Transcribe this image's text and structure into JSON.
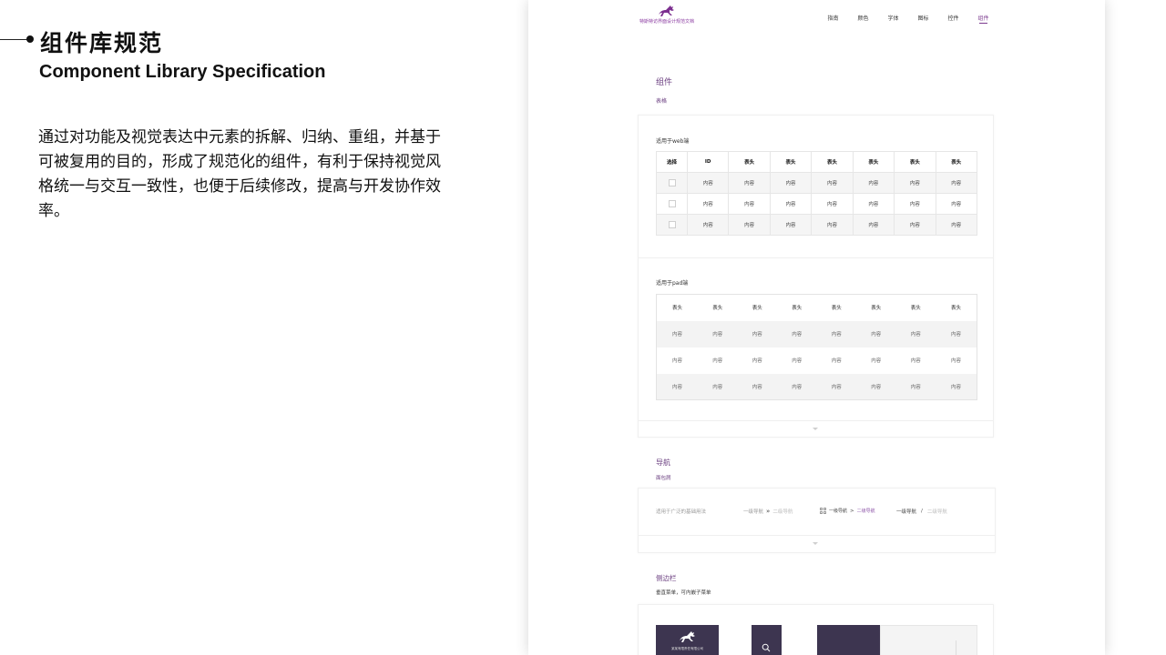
{
  "heading": {
    "title_cn": "组件库规范",
    "title_en": "Component Library Specification",
    "description": "通过对功能及视觉表达中元素的拆解、归纳、重组，并基于可被复用的目的，形成了规范化的组件，有利于保持视觉风格统一与交互一致性，也便于后续修改，提高与开发协作效率。"
  },
  "mock": {
    "logo_text": "特斯特访界面设计规范文档",
    "nav": [
      "指南",
      "颜色",
      "字体",
      "图标",
      "控件",
      "组件"
    ],
    "active_nav": "组件",
    "components_title": "组件",
    "table_section": "表格",
    "web_label": "适用于web端",
    "web_headers": [
      "选择",
      "ID",
      "表头",
      "表头",
      "表头",
      "表头",
      "表头",
      "表头"
    ],
    "web_cell": "内容",
    "pad_label": "适用于pad端",
    "pad_header": "表头",
    "pad_cell": "内容",
    "nav_section": "导航",
    "breadcrumb_label": "面包屑",
    "nav_usage": "适用于广泛的基础用法",
    "crumb_level1": "一级导航",
    "crumb_level2": "二级导航",
    "crumb_sep_arrows": "»",
    "crumb_sep_gt": ">",
    "crumb_sep_slash": "/",
    "sidebar_section": "侧边栏",
    "sidebar_desc": "垂直菜单，可内嵌子菜单",
    "sidebar_logo_text": "某某有限责任有限公司"
  },
  "colors": {
    "accent": "#7c3b8f",
    "sidebar_dark": "#3d3550"
  }
}
